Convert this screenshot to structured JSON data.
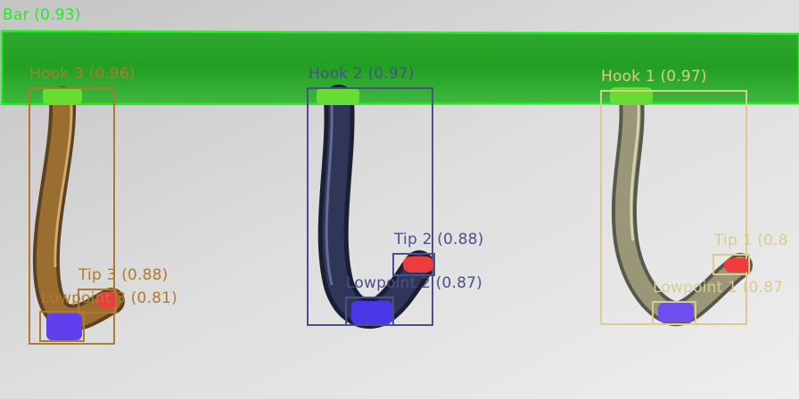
{
  "colors": {
    "bar": "#22dd22",
    "hook3": "#b07a2c",
    "hook2": "#4a5088",
    "hook1": "#d8cc90",
    "tip": "#ee3b3b",
    "lowpoint": "#5a40f0"
  },
  "detections": {
    "bar": "Bar (0.93)",
    "hook3": "Hook 3 (0.96)",
    "hook2": "Hook 2 (0.97)",
    "hook1": "Hook 1 (0.97)",
    "tip3": "Tip 3 (0.88)",
    "tip2": "Tip 2 (0.88)",
    "tip1": "Tip 1 (0.8",
    "low3": "Lowpoint 3 (0.81)",
    "low2": "Lowpoint 2 (0.87)",
    "low1": "Lowpoint 1 (0.87"
  }
}
